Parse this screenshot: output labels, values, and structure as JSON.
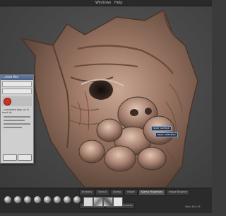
{
  "menubar": {
    "items": [
      "Windows",
      "Help"
    ]
  },
  "dialog": {
    "title_snippet": "...nect the",
    "message_snippet": "...connected topo. on hi mesh its"
  },
  "callouts": [
    "layer surface",
    "layer selection"
  ],
  "bottom_tabs": [
    "Brushes",
    "Stencil",
    "Stamp",
    "Falloff",
    "Stamp Properties",
    "Image Browser",
    "Lighting Presets",
    "Camera Bookmarks"
  ],
  "active_tab_index": 4,
  "icons": {
    "warning": "warning-icon",
    "sphere": "brush-sphere-icon"
  },
  "status": {
    "bottom_right": "Total: 98.0 SP"
  }
}
